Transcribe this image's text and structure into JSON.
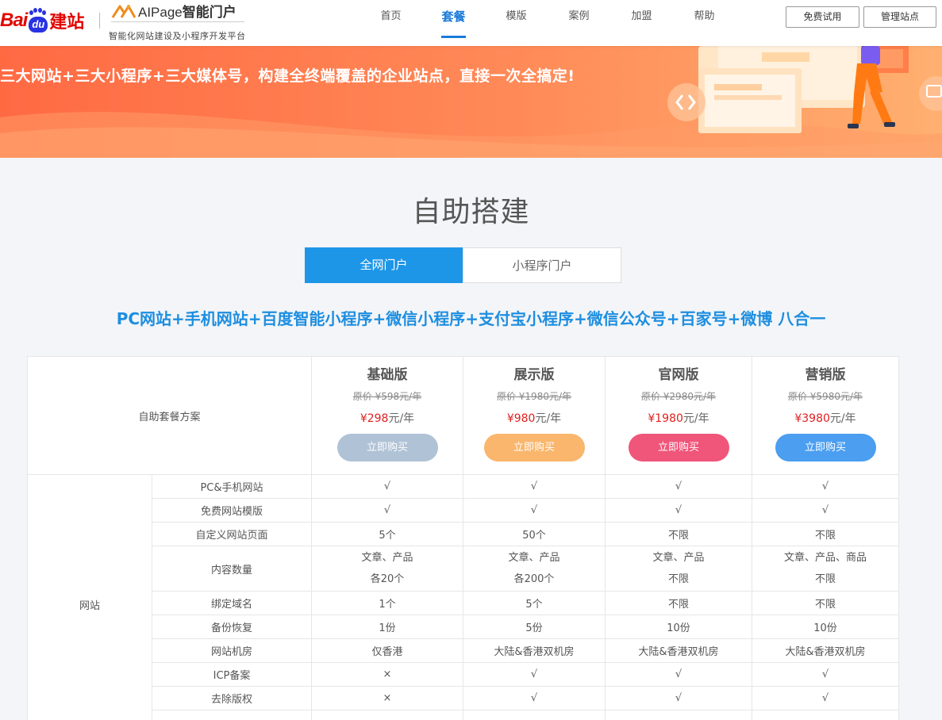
{
  "header": {
    "baidu_logo": {
      "bai": "Bai",
      "du": "du",
      "jianzhan": "建站"
    },
    "aipage_logo": {
      "name_latin": "AIPage",
      "name_cn": "智能门户",
      "slogan": "智能化网站建设及小程序开发平台"
    },
    "nav": [
      {
        "label": "首页",
        "active": false
      },
      {
        "label": "套餐",
        "active": true
      },
      {
        "label": "模版",
        "active": false
      },
      {
        "label": "案例",
        "active": false
      },
      {
        "label": "加盟",
        "active": false
      },
      {
        "label": "帮助",
        "active": false
      }
    ],
    "trial_button": "免费试用",
    "admin_button": "管理站点"
  },
  "banner": {
    "text": "三大网站+三大小程序+三大媒体号，构建全终端覆盖的企业站点，直接一次全搞定!"
  },
  "section": {
    "title": "自助搭建",
    "tabs": [
      {
        "label": "全网门户",
        "active": true
      },
      {
        "label": "小程序门户",
        "active": false
      }
    ],
    "slogan": "PC网站+手机网站+百度智能小程序+微信小程序+支付宝小程序+微信公众号+百家号+微博 八合一"
  },
  "table": {
    "header_label": "自助套餐方案",
    "plans": [
      {
        "name": "基础版",
        "original": "原价 ¥598元/年",
        "price_num": "¥298",
        "price_unit": "元/年",
        "buy": "立即购买",
        "color": "#b0c2d6"
      },
      {
        "name": "展示版",
        "original": "原价 ¥1980元/年",
        "price_num": "¥980",
        "price_unit": "元/年",
        "buy": "立即购买",
        "color": "#f9b66c"
      },
      {
        "name": "官网版",
        "original": "原价 ¥2980元/年",
        "price_num": "¥1980",
        "price_unit": "元/年",
        "buy": "立即购买",
        "color": "#f0557a"
      },
      {
        "name": "营销版",
        "original": "原价 ¥5980元/年",
        "price_num": "¥3980",
        "price_unit": "元/年",
        "buy": "立即购买",
        "color": "#4b9ef0"
      }
    ],
    "group_label": "网站",
    "rows": [
      {
        "feature": "PC&手机网站",
        "values": [
          "√",
          "√",
          "√",
          "√"
        ]
      },
      {
        "feature": "免费网站模版",
        "values": [
          "√",
          "√",
          "√",
          "√"
        ]
      },
      {
        "feature": "自定义网站页面",
        "values": [
          "5个",
          "50个",
          "不限",
          "不限"
        ]
      },
      {
        "feature": "内容数量",
        "values": [
          [
            "文章、产品",
            "各20个"
          ],
          [
            "文章、产品",
            "各200个"
          ],
          [
            "文章、产品",
            "不限"
          ],
          [
            "文章、产品、商品",
            "不限"
          ]
        ]
      },
      {
        "feature": "绑定域名",
        "values": [
          "1个",
          "5个",
          "不限",
          "不限"
        ]
      },
      {
        "feature": "备份恢复",
        "values": [
          "1份",
          "5份",
          "10份",
          "10份"
        ]
      },
      {
        "feature": "网站机房",
        "values": [
          "仅香港",
          "大陆&香港双机房",
          "大陆&香港双机房",
          "大陆&香港双机房"
        ]
      },
      {
        "feature": "ICP备案",
        "values": [
          "×",
          "√",
          "√",
          "√"
        ]
      },
      {
        "feature": "去除版权",
        "values": [
          "×",
          "√",
          "√",
          "√"
        ]
      }
    ]
  },
  "colors": {
    "accent": "#1e96e8",
    "check": "#3aaa35",
    "cross": "#e02020",
    "price": "#e02020"
  }
}
